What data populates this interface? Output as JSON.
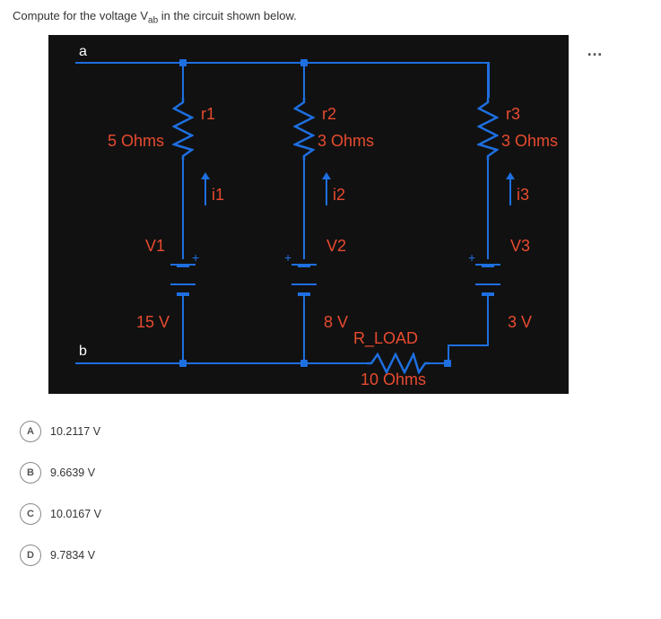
{
  "question": {
    "prefix": "Compute for the voltage V",
    "sub": "ab",
    "suffix": " in the circuit shown below."
  },
  "diagram": {
    "terminals": {
      "a": "a",
      "b": "b"
    },
    "branches": [
      {
        "r_name": "r1",
        "r_val": "5 Ohms",
        "i_name": "i1",
        "v_name": "V1",
        "v_val": "15 V"
      },
      {
        "r_name": "r2",
        "r_val": "3 Ohms",
        "i_name": "i2",
        "v_name": "V2",
        "v_val": "8 V"
      },
      {
        "r_name": "r3",
        "r_val": "3 Ohms",
        "i_name": "i3",
        "v_name": "V3",
        "v_val": "3 V"
      }
    ],
    "load": {
      "name": "R_LOAD",
      "val": "10 Ohms"
    },
    "plus": "+"
  },
  "more_icon": "…",
  "options": [
    {
      "letter": "A",
      "text": "10.2117 V"
    },
    {
      "letter": "B",
      "text": "9.6639 V"
    },
    {
      "letter": "C",
      "text": "10.0167 V"
    },
    {
      "letter": "D",
      "text": "9.7834 V"
    }
  ]
}
